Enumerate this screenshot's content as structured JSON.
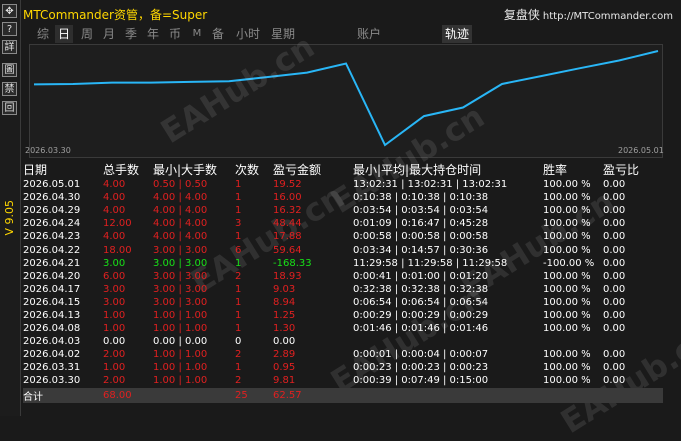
{
  "sidebar": {
    "buttons": [
      "✥",
      "?",
      "詳",
      "圖",
      "禁",
      "回"
    ],
    "version": "V 9.05"
  },
  "header": {
    "title": "MTCommander资管，备=Super",
    "brand": "复盘侠",
    "url": "http://MTCommander.com"
  },
  "tabs": [
    "综",
    "日",
    "周",
    "月",
    "季",
    "年",
    "币",
    "M",
    "备",
    "小时",
    "星期",
    "账户",
    "轨迹"
  ],
  "chart": {
    "start_label": "2026.03.30",
    "end_label": "2026.05.01",
    "line_color": "#29b6f6"
  },
  "chart_data": {
    "type": "line",
    "x": [
      "2026.03.30",
      "2026.03.31",
      "2026.04.02",
      "2026.04.03",
      "2026.04.08",
      "2026.04.13",
      "2026.04.15",
      "2026.04.17",
      "2026.04.20",
      "2026.04.21",
      "2026.04.22",
      "2026.04.23",
      "2026.04.24",
      "2026.04.28",
      "2026.04.29",
      "2026.04.30",
      "2026.05.01"
    ],
    "values": [
      9.81,
      10.76,
      13.65,
      13.65,
      14.95,
      16.2,
      25.14,
      34.17,
      53.1,
      -115.23,
      -55.64,
      -37.76,
      10.68,
      27.0,
      43.32,
      59.32,
      78.84
    ],
    "title": "",
    "xlabel": "",
    "ylabel": ""
  },
  "table": {
    "headers": [
      "日期",
      "总手数",
      "最小|大手数",
      "次数",
      "盈亏金额",
      "最小|平均|最大持仓时间",
      "胜率",
      "盈亏比"
    ],
    "rows": [
      {
        "date": "2026.05.01",
        "lots": "4.00",
        "minmax": "0.50 | 0.50",
        "count": "1",
        "pnl": "19.52",
        "time": "13:02:31 | 13:02:31 | 13:02:31",
        "win": "100.00 %",
        "ratio": "0.00",
        "color": "red"
      },
      {
        "date": "2026.04.30",
        "lots": "4.00",
        "minmax": "4.00 | 4.00",
        "count": "1",
        "pnl": "16.00",
        "time": "0:10:38 | 0:10:38 | 0:10:38",
        "win": "100.00 %",
        "ratio": "0.00",
        "color": "red"
      },
      {
        "date": "2026.04.29",
        "lots": "4.00",
        "minmax": "4.00 | 4.00",
        "count": "1",
        "pnl": "16.32",
        "time": "0:03:54 | 0:03:54 | 0:03:54",
        "win": "100.00 %",
        "ratio": "0.00",
        "color": "red"
      },
      {
        "date": "2026.04.24",
        "lots": "12.00",
        "minmax": "4.00 | 4.00",
        "count": "3",
        "pnl": "48.44",
        "time": "0:01:09 | 0:16:47 | 0:45:28",
        "win": "100.00 %",
        "ratio": "0.00",
        "color": "red"
      },
      {
        "date": "2026.04.23",
        "lots": "4.00",
        "minmax": "4.00 | 4.00",
        "count": "1",
        "pnl": "17.88",
        "time": "0:00:58 | 0:00:58 | 0:00:58",
        "win": "100.00 %",
        "ratio": "0.00",
        "color": "red"
      },
      {
        "date": "2026.04.22",
        "lots": "18.00",
        "minmax": "3.00 | 3.00",
        "count": "6",
        "pnl": "59.64",
        "time": "0:03:34 | 0:14:57 | 0:30:36",
        "win": "100.00 %",
        "ratio": "0.00",
        "color": "red"
      },
      {
        "date": "2026.04.21",
        "lots": "3.00",
        "minmax": "3.00 | 3.00",
        "count": "1",
        "pnl": "-168.33",
        "time": "11:29:58 | 11:29:58 | 11:29:58",
        "win": "-100.00 %",
        "ratio": "0.00",
        "color": "green"
      },
      {
        "date": "2026.04.20",
        "lots": "6.00",
        "minmax": "3.00 | 3.00",
        "count": "2",
        "pnl": "18.93",
        "time": "0:00:41 | 0:01:00 | 0:01:20",
        "win": "100.00 %",
        "ratio": "0.00",
        "color": "red"
      },
      {
        "date": "2026.04.17",
        "lots": "3.00",
        "minmax": "3.00 | 3.00",
        "count": "1",
        "pnl": "9.03",
        "time": "0:32:38 | 0:32:38 | 0:32:38",
        "win": "100.00 %",
        "ratio": "0.00",
        "color": "red"
      },
      {
        "date": "2026.04.15",
        "lots": "3.00",
        "minmax": "3.00 | 3.00",
        "count": "1",
        "pnl": "8.94",
        "time": "0:06:54 | 0:06:54 | 0:06:54",
        "win": "100.00 %",
        "ratio": "0.00",
        "color": "red"
      },
      {
        "date": "2026.04.13",
        "lots": "1.00",
        "minmax": "1.00 | 1.00",
        "count": "1",
        "pnl": "1.25",
        "time": "0:00:29 | 0:00:29 | 0:00:29",
        "win": "100.00 %",
        "ratio": "0.00",
        "color": "red"
      },
      {
        "date": "2026.04.08",
        "lots": "1.00",
        "minmax": "1.00 | 1.00",
        "count": "1",
        "pnl": "1.30",
        "time": "0:01:46 | 0:01:46 | 0:01:46",
        "win": "100.00 %",
        "ratio": "0.00",
        "color": "red"
      },
      {
        "date": "2026.04.03",
        "lots": "0.00",
        "minmax": "0.00 | 0.00",
        "count": "0",
        "pnl": "0.00",
        "time": "",
        "win": "",
        "ratio": "",
        "color": "white"
      },
      {
        "date": "2026.04.02",
        "lots": "2.00",
        "minmax": "1.00 | 1.00",
        "count": "2",
        "pnl": "2.89",
        "time": "0:00:01 | 0:00:04 | 0:00:07",
        "win": "100.00 %",
        "ratio": "0.00",
        "color": "red"
      },
      {
        "date": "2026.03.31",
        "lots": "1.00",
        "minmax": "1.00 | 1.00",
        "count": "1",
        "pnl": "0.95",
        "time": "0:00:23 | 0:00:23 | 0:00:23",
        "win": "100.00 %",
        "ratio": "0.00",
        "color": "red"
      },
      {
        "date": "2026.03.30",
        "lots": "2.00",
        "minmax": "1.00 | 1.00",
        "count": "2",
        "pnl": "9.81",
        "time": "0:00:39 | 0:07:49 | 0:15:00",
        "win": "100.00 %",
        "ratio": "0.00",
        "color": "red"
      }
    ],
    "total": {
      "label": "合计",
      "lots": "68.00",
      "count": "25",
      "pnl": "62.57"
    }
  }
}
